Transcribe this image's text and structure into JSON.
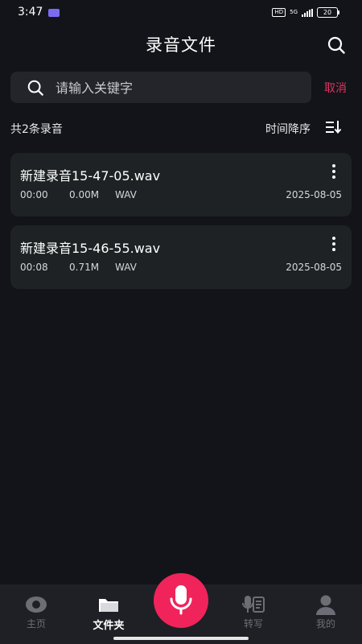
{
  "status_bar": {
    "time": "3:47",
    "hd": "HD",
    "network": "5G",
    "battery": "20"
  },
  "header": {
    "title": "录音文件",
    "search_icon": "search-icon"
  },
  "search": {
    "placeholder": "请输入关键字",
    "value": "",
    "cancel_label": "取消"
  },
  "list_header": {
    "count_label": "共2条录音",
    "sort_label": "时间降序",
    "sort_icon": "sort-descending-icon"
  },
  "recordings": [
    {
      "name": "新建录音15-47-05.wav",
      "duration": "00:00",
      "size": "0.00M",
      "format": "WAV",
      "date": "2025-08-05"
    },
    {
      "name": "新建录音15-46-55.wav",
      "duration": "00:08",
      "size": "0.71M",
      "format": "WAV",
      "date": "2025-08-05"
    }
  ],
  "bottom_nav": {
    "items": [
      {
        "label": "主页",
        "icon": "home-icon",
        "active": false
      },
      {
        "label": "文件夹",
        "icon": "folder-icon",
        "active": true
      },
      {
        "label": "转写",
        "icon": "transcribe-icon",
        "active": false
      },
      {
        "label": "我的",
        "icon": "profile-icon",
        "active": false
      }
    ],
    "record_icon": "microphone-icon"
  },
  "colors": {
    "background": "#131419",
    "accent": "#f0245a",
    "cancel": "#e0325f",
    "card": "#1e2224"
  }
}
